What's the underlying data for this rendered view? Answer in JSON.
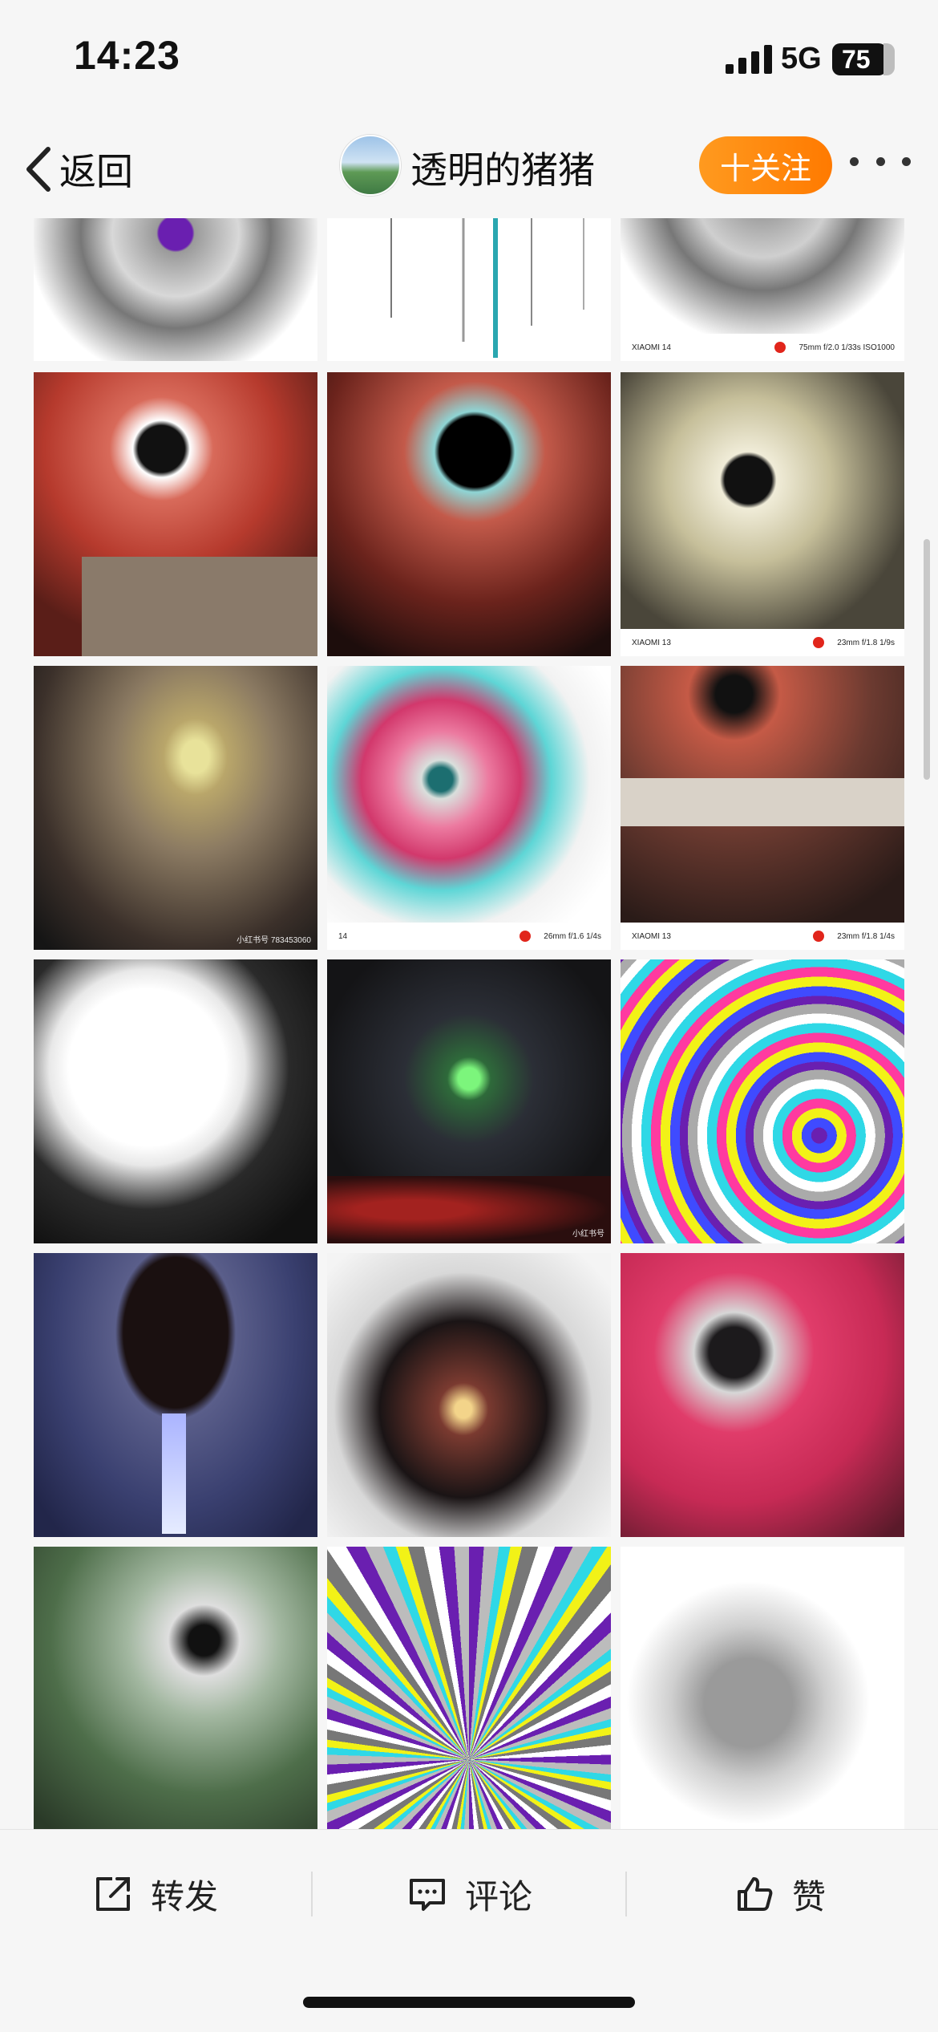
{
  "status_bar": {
    "time": "14:23",
    "network": "5G",
    "battery": "75"
  },
  "nav": {
    "back_label": "返回",
    "username": "透明的猪猪",
    "follow_label": "十关注"
  },
  "grid": {
    "tiles": [
      {
        "id": "t0",
        "caption": null
      },
      {
        "id": "t1",
        "caption": null
      },
      {
        "id": "t2",
        "caption": {
          "device": "XIAOMI 14",
          "spec": "75mm f/2.0 1/33s ISO1000"
        }
      },
      {
        "id": "t3",
        "caption": null
      },
      {
        "id": "t4",
        "caption": null
      },
      {
        "id": "t5",
        "caption": {
          "device": "XIAOMI 13",
          "spec": "23mm f/1.8 1/9s"
        }
      },
      {
        "id": "t6",
        "caption": null,
        "watermark": "小红书号 783453060"
      },
      {
        "id": "t7",
        "caption": {
          "device": "14",
          "spec": "26mm f/1.6 1/4s"
        }
      },
      {
        "id": "t8",
        "caption": {
          "device": "XIAOMI 13",
          "spec": "23mm f/1.8 1/4s"
        }
      },
      {
        "id": "t9",
        "caption": null
      },
      {
        "id": "t10",
        "caption": null,
        "watermark": "小红书号"
      },
      {
        "id": "t11",
        "caption": null
      },
      {
        "id": "t12",
        "caption": null
      },
      {
        "id": "t13",
        "caption": null
      },
      {
        "id": "t14",
        "caption": null
      },
      {
        "id": "t15",
        "caption": null
      },
      {
        "id": "t16",
        "caption": null
      },
      {
        "id": "t17",
        "caption": null
      }
    ]
  },
  "actions": {
    "share_label": "转发",
    "comment_label": "评论",
    "like_label": "赞"
  },
  "colors": {
    "accent": "#ff8a00",
    "background": "#f6f6f6"
  },
  "icons": [
    "chevron-left-icon",
    "more-icon",
    "share-icon",
    "comment-icon",
    "thumbs-up-icon"
  ]
}
